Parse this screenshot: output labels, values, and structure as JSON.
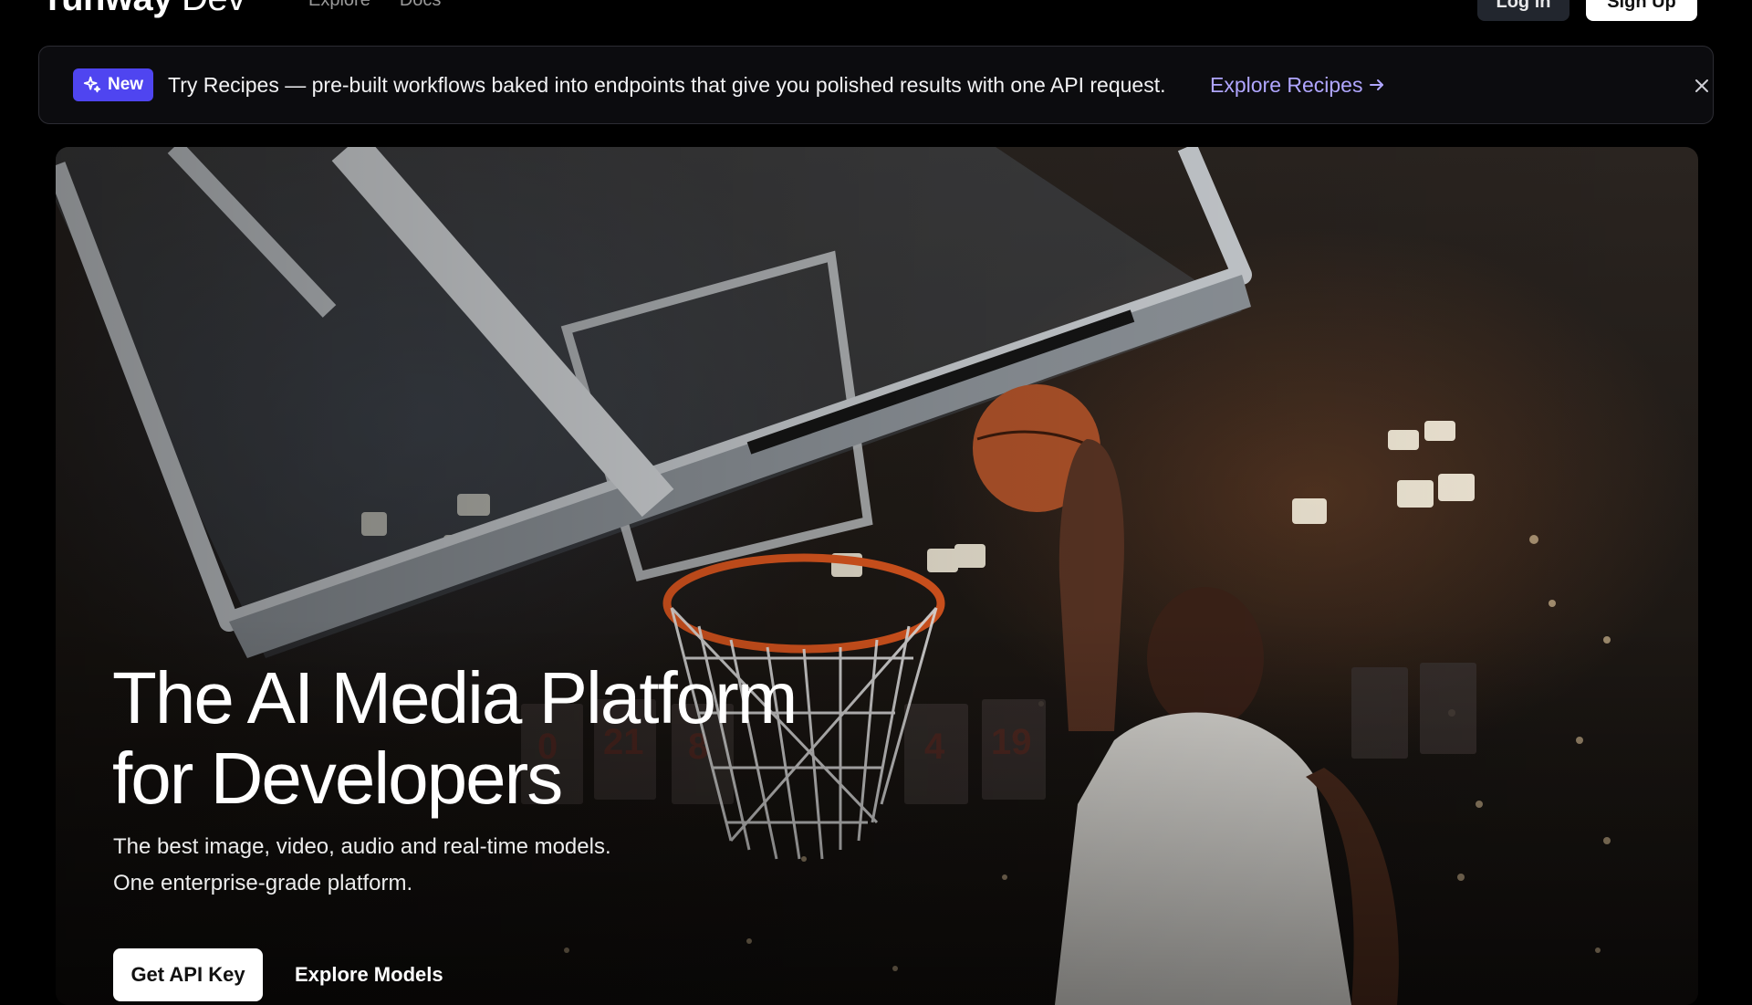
{
  "nav": {
    "brand_main": "runway",
    "brand_sub": "Dev",
    "links": [
      "Explore",
      "Docs"
    ],
    "login_label": "Log in",
    "signup_label": "Sign Up"
  },
  "banner": {
    "badge_label": "New",
    "text": "Try Recipes — pre-built workflows baked into endpoints that give you polished results with one API request.",
    "link_label": "Explore Recipes"
  },
  "hero": {
    "title_line1": "The AI Media Platform",
    "title_line2": "for Developers",
    "subtitle_line1": "The best image, video, audio and real-time models.",
    "subtitle_line2": "One enterprise-grade platform.",
    "primary_cta": "Get API Key",
    "secondary_cta": "Explore Models",
    "banner_numbers": [
      "0",
      "21",
      "8",
      "4",
      "19"
    ]
  },
  "colors": {
    "page_bg": "#000000",
    "badge_bg": "#4f45f0",
    "link": "#b0a6ff",
    "rim": "#e0581f"
  },
  "icons": {
    "badge": "sparkle-icon",
    "link": "arrow-right-icon",
    "close": "close-icon"
  }
}
